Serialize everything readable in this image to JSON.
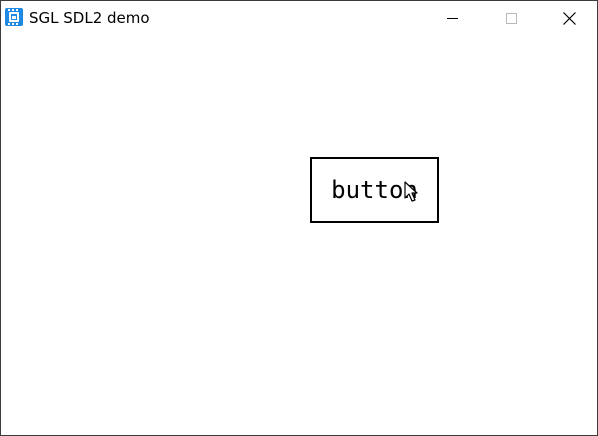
{
  "window": {
    "title": "SGL SDL2 demo",
    "app_icon": "chip-icon",
    "controls": {
      "minimize_icon": "minimize-icon",
      "maximize_icon": "maximize-icon",
      "close_icon": "close-icon"
    }
  },
  "canvas": {
    "button_label": "button"
  },
  "cursor": {
    "icon": "mouse-pointer-icon"
  },
  "colors": {
    "background": "#ffffff",
    "text": "#000000",
    "app_icon": "#1e88e5",
    "maximize_disabled": "#b8b8b8"
  }
}
